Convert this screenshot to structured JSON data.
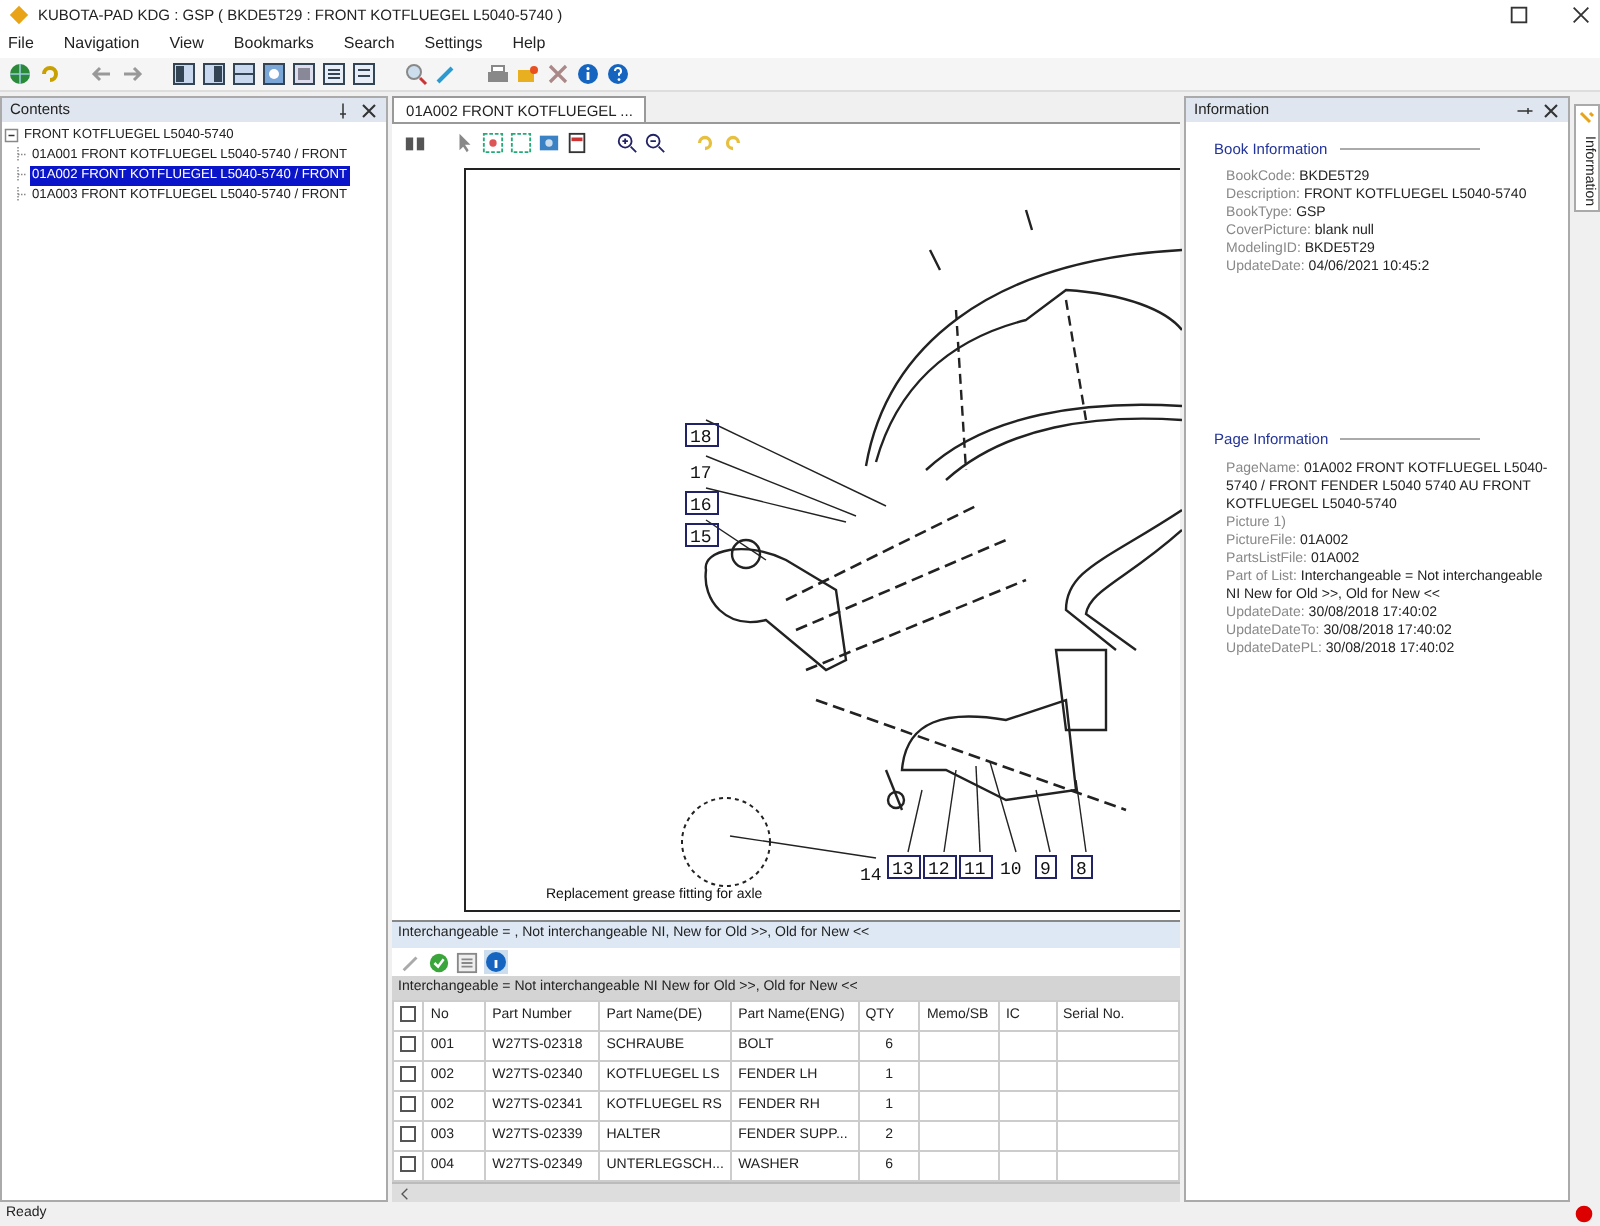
{
  "window": {
    "title": "KUBOTA-PAD KDG : GSP ( BKDE5T29 : FRONT KOTFLUEGEL L5040-5740 )"
  },
  "menu": [
    "File",
    "Navigation",
    "View",
    "Bookmarks",
    "Search",
    "Settings",
    "Help"
  ],
  "contents": {
    "title": "Contents",
    "tree": [
      {
        "label": "FRONT KOTFLUEGEL L5040-5740",
        "expanded": true,
        "selected": false,
        "children": [
          {
            "label": "01A001  FRONT KOTFLUEGEL L5040-5740 / FRONT",
            "selected": false
          },
          {
            "label": "01A002  FRONT KOTFLUEGEL L5040-5740 / FRONT",
            "selected": true
          },
          {
            "label": "01A003  FRONT KOTFLUEGEL L5040-5740 / FRONT",
            "selected": false
          }
        ]
      }
    ]
  },
  "document_tab": {
    "label": "01A002  FRONT KOTFLUEGEL ...",
    "selected": true
  },
  "drawing": {
    "callouts": [
      "18",
      "17",
      "16",
      "15",
      "14",
      "13",
      "12",
      "11",
      "10",
      "9",
      "8"
    ],
    "caption": "Replacement grease fitting for axle"
  },
  "legend": "Interchangeable = , Not interchangeable NI, New for Old >>, Old for New <<",
  "parts_table": {
    "legend": "Interchangeable = Not interchangeable NI New for Old >>, Old for New <<",
    "columns": [
      "No",
      "Part Number",
      "Part Name(DE)",
      "Part Name(ENG)",
      "QTY",
      "Memo/SB",
      "IC",
      "Serial No."
    ],
    "header_checked": false,
    "rows": [
      {
        "checked": false,
        "cells": [
          "001",
          "W27TS-02318",
          "SCHRAUBE",
          "BOLT",
          "6",
          "",
          "",
          ""
        ]
      },
      {
        "checked": false,
        "cells": [
          "002",
          "W27TS-02340",
          "KOTFLUEGEL LS",
          "FENDER LH",
          "1",
          "",
          "",
          ""
        ]
      },
      {
        "checked": false,
        "cells": [
          "002",
          "W27TS-02341",
          "KOTFLUEGEL RS",
          "FENDER RH",
          "1",
          "",
          "",
          ""
        ]
      },
      {
        "checked": false,
        "cells": [
          "003",
          "W27TS-02339",
          "HALTER",
          "FENDER SUPP...",
          "2",
          "",
          "",
          ""
        ]
      },
      {
        "checked": false,
        "cells": [
          "004",
          "W27TS-02349",
          "UNTERLEGSCH...",
          "WASHER",
          "6",
          "",
          "",
          ""
        ]
      }
    ]
  },
  "information": {
    "title": "Information",
    "sections": [
      {
        "title": "Book Information",
        "fields": [
          {
            "label": "BookCode:",
            "value": "BKDE5T29"
          },
          {
            "label": "Description:",
            "value": "FRONT KOTFLUEGEL L5040-5740"
          },
          {
            "label": "BookType:",
            "value": "GSP"
          },
          {
            "label": "CoverPicture:",
            "value": "blank null"
          },
          {
            "label": "ModelingID:",
            "value": "BKDE5T29"
          },
          {
            "label": "UpdateDate:",
            "value": "04/06/2021 10:45:2"
          }
        ]
      },
      {
        "title": "Page Information",
        "fields": [
          {
            "label": "PageName:",
            "value": "01A002  FRONT KOTFLUEGEL L5040-5740 / FRONT FENDER L5040 5740 AU FRONT KOTFLUEGEL L5040-5740"
          },
          {
            "label": "Picture 1)"
          },
          {
            "label": "PictureFile:",
            "value": "01A002"
          },
          {
            "label": "PartsListFile:",
            "value": "01A002"
          },
          {
            "label": "Part of List:",
            "value": "Interchangeable = Not interchangeable NI New for Old >>, Old for New <<"
          },
          {
            "label": "UpdateDate:",
            "value": "30/08/2018 17:40:02"
          },
          {
            "label": "UpdateDateTo:",
            "value": "30/08/2018 17:40:02"
          },
          {
            "label": "UpdateDatePL:",
            "value": "30/08/2018 17:40:02"
          }
        ]
      }
    ]
  },
  "side_tab": {
    "label": "Information"
  },
  "status_bar": {
    "text": "Ready"
  }
}
